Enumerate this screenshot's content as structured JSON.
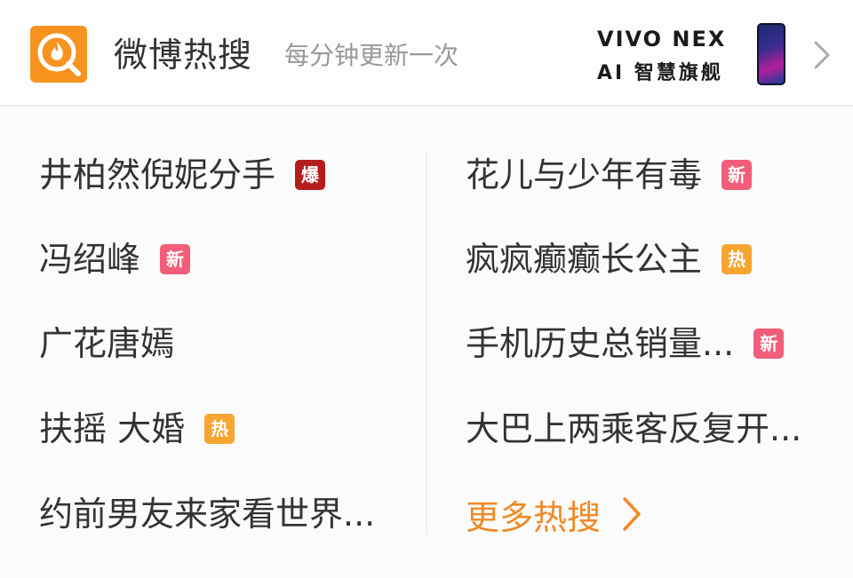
{
  "header": {
    "title": "微博热搜",
    "subtitle": "每分钟更新一次",
    "ad_brand": "VIVO NEX",
    "ad_tagline": "AI 智慧旗舰",
    "logo_icon": "weibo-search-flame-icon",
    "chevron_icon": "chevron-right-icon"
  },
  "colors": {
    "accent": "#f08a24",
    "badge_bao": "#b51d1d",
    "badge_xin": "#f25d7a",
    "badge_re": "#f7a531"
  },
  "left_items": [
    {
      "text": "井柏然倪妮分手",
      "badge": "爆",
      "badge_type": "bao"
    },
    {
      "text": "冯绍峰",
      "badge": "新",
      "badge_type": "xin"
    },
    {
      "text": "广花唐嫣",
      "badge": "",
      "badge_type": ""
    },
    {
      "text": "扶摇 大婚",
      "badge": "热",
      "badge_type": "re"
    },
    {
      "text": "约前男友来家看世界...",
      "badge": "",
      "badge_type": ""
    }
  ],
  "right_items": [
    {
      "text": "花儿与少年有毒",
      "badge": "新",
      "badge_type": "xin"
    },
    {
      "text": "疯疯癫癫长公主",
      "badge": "热",
      "badge_type": "re"
    },
    {
      "text": "手机历史总销量...",
      "badge": "新",
      "badge_type": "xin"
    },
    {
      "text": "大巴上两乘客反复开...",
      "badge": "",
      "badge_type": ""
    }
  ],
  "more": {
    "label": "更多热搜",
    "icon": "chevron-right-icon"
  }
}
